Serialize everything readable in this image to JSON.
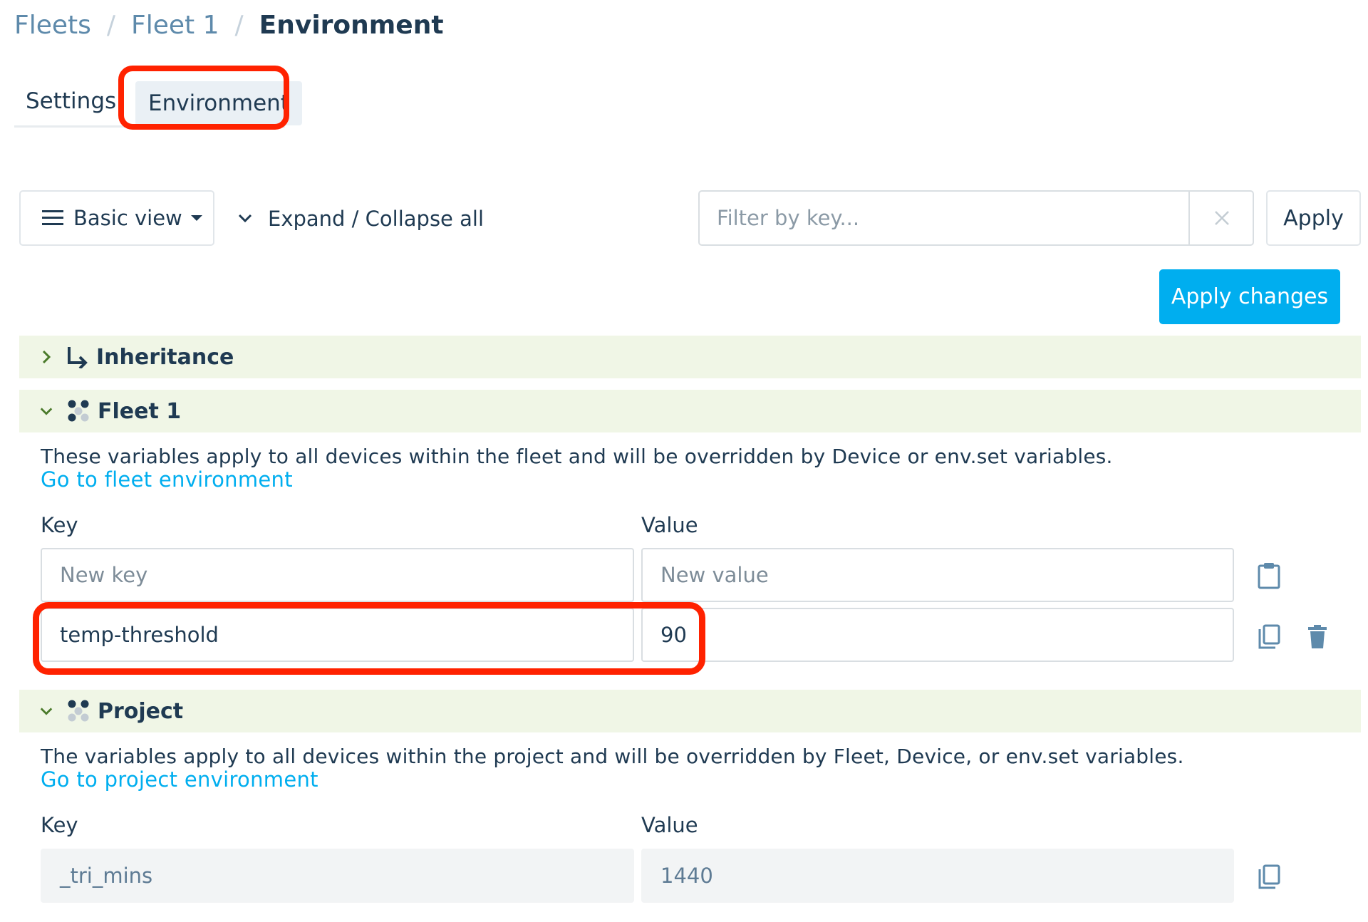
{
  "breadcrumb": {
    "items": [
      "Fleets",
      "Fleet 1"
    ],
    "current": "Environment",
    "separator": "/"
  },
  "tabs": {
    "settings": "Settings",
    "environment": "Environment"
  },
  "toolbar": {
    "view_label": "Basic view",
    "expand_label": "Expand / Collapse all",
    "filter_placeholder": "Filter by key...",
    "apply_label": "Apply",
    "apply_changes_label": "Apply changes"
  },
  "sections": {
    "inheritance": {
      "title": "Inheritance",
      "expanded": false
    },
    "fleet": {
      "title": "Fleet 1",
      "expanded": true,
      "description": "These variables apply to all devices within the fleet and will be overridden by Device or env.set variables.",
      "link": "Go to fleet environment",
      "key_label": "Key",
      "value_label": "Value",
      "new_key_placeholder": "New key",
      "new_value_placeholder": "New value",
      "rows": [
        {
          "key": "temp-threshold",
          "value": "90"
        }
      ]
    },
    "project": {
      "title": "Project",
      "expanded": true,
      "description": "The variables apply to all devices within the project and will be overridden by Fleet, Device, or env.set variables.",
      "link": "Go to project environment",
      "key_label": "Key",
      "value_label": "Value",
      "rows": [
        {
          "key": "_tri_mins",
          "value": "1440"
        }
      ]
    }
  },
  "colors": {
    "accent": "#00aeef",
    "highlight": "#ff2200",
    "section_bg": "#f0f6e6",
    "text": "#1f3a52"
  }
}
